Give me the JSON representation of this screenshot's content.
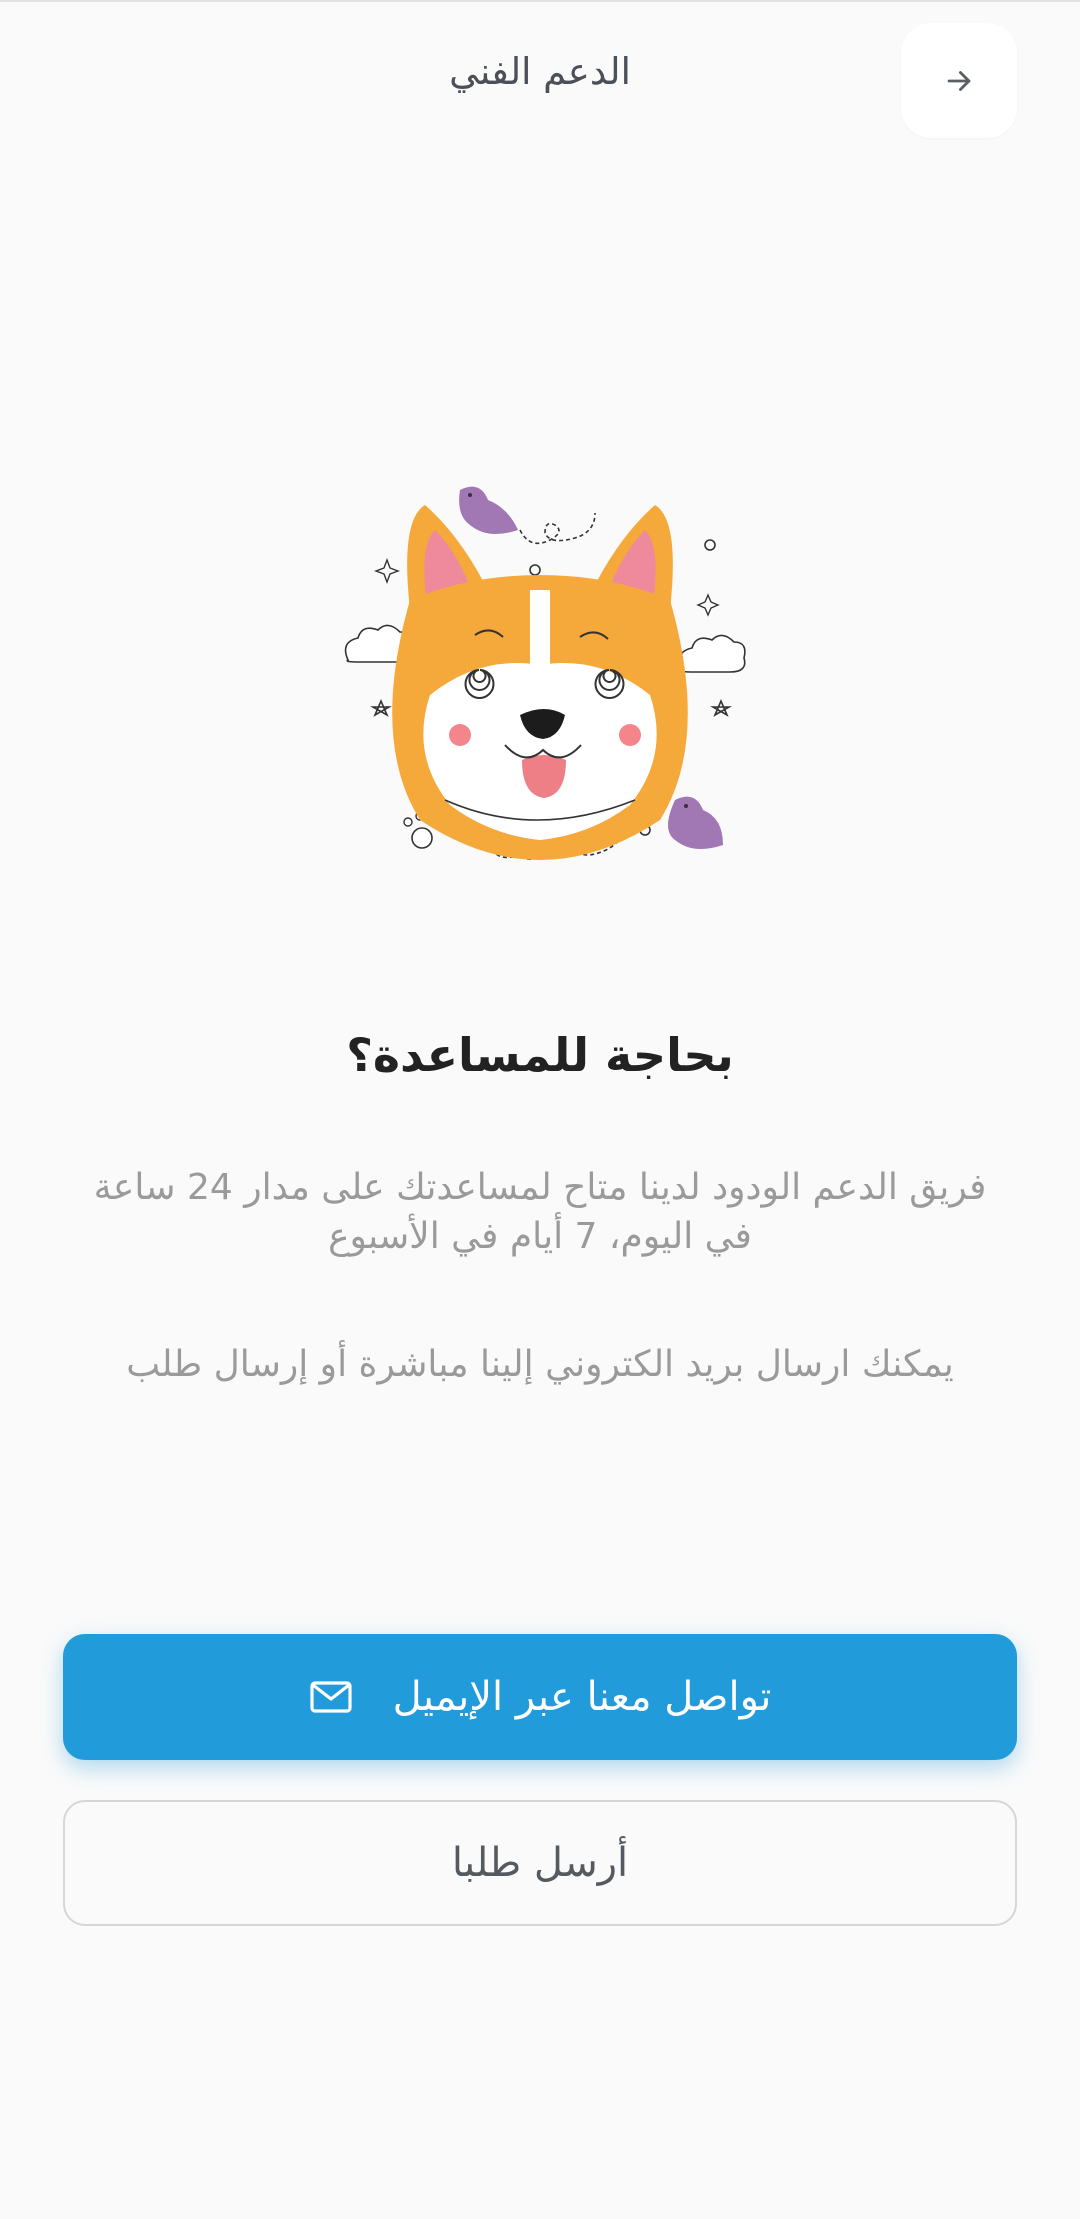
{
  "header": {
    "title": "الدعم الفني",
    "back_icon": "arrow-right-icon"
  },
  "illustration": {
    "icon": "corgi-dog-illustration",
    "colors": {
      "fur": "#f6a93b",
      "ear_inner": "#ee8a9b",
      "face_white": "#ffffff",
      "cheeks": "#f4858a",
      "tongue": "#ee7f86",
      "bird": "#a177b4"
    }
  },
  "main": {
    "heading": "بحاجة للمساعدة؟",
    "paragraph_1": "فريق الدعم الودود لدينا متاح لمساعدتك على مدار 24 ساعة في اليوم، 7 أيام في الأسبوع",
    "paragraph_2": "يمكنك ارسال بريد الكتروني إلينا مباشرة أو إرسال طلب"
  },
  "actions": {
    "email_button_label": "تواصل معنا عبر الإيميل",
    "email_icon": "mail-icon",
    "request_button_label": "أرسل طلبا"
  },
  "colors": {
    "background": "#fafafa",
    "primary": "#229bdb",
    "heading_text": "#222222",
    "body_text": "#9a9a9a"
  }
}
